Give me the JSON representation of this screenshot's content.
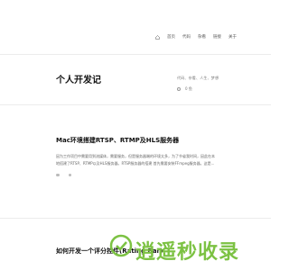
{
  "nav": {
    "items": [
      {
        "label": "首页"
      },
      {
        "label": "代码"
      },
      {
        "label": "杂看"
      },
      {
        "label": "链接"
      },
      {
        "label": "关于"
      }
    ]
  },
  "site": {
    "title": "个人开发记",
    "tagline": "代码、杂看、人生、梦想",
    "meta": "0  鱼"
  },
  "posts": [
    {
      "title": "Mac环境搭建RTSP、RTMP及HLS服务器",
      "excerpt": "因为工作项目中需要用到流媒体，需要服务，但是服务器端的环境太多，为了节省我时间，因此在本地搭建了RTSP、RTMP以及HLS服务器。RTSP服务器的搭建 首先需要安装FFmpeg服务器。这是..."
    },
    {
      "title": "如何开发一个评分控件(Rating Bar)"
    }
  ],
  "watermark": {
    "text": "逍遥秒收录"
  },
  "colors": {
    "accent": "#7cc243"
  }
}
